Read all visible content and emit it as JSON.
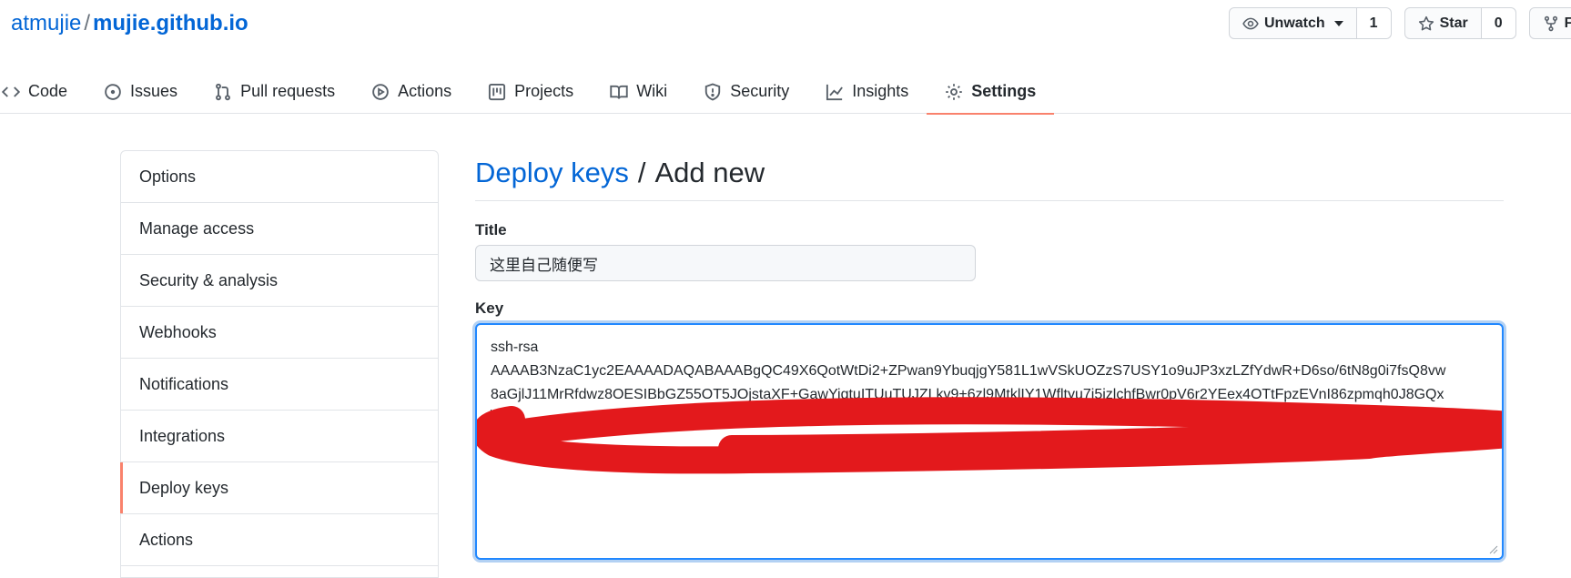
{
  "repo": {
    "owner": "atmujie",
    "separator": "/",
    "name": "mujie.github.io"
  },
  "actions": {
    "watch_label": "Unwatch",
    "watch_count": "1",
    "star_label": "Star",
    "star_count": "0",
    "fork_label": "Fo"
  },
  "tabs": [
    {
      "label": "Code",
      "icon": "code-icon"
    },
    {
      "label": "Issues",
      "icon": "issue-icon"
    },
    {
      "label": "Pull requests",
      "icon": "pull-request-icon"
    },
    {
      "label": "Actions",
      "icon": "play-icon"
    },
    {
      "label": "Projects",
      "icon": "project-icon"
    },
    {
      "label": "Wiki",
      "icon": "book-icon"
    },
    {
      "label": "Security",
      "icon": "shield-icon"
    },
    {
      "label": "Insights",
      "icon": "graph-icon"
    },
    {
      "label": "Settings",
      "icon": "gear-icon",
      "active": true
    }
  ],
  "sidebar": {
    "items": [
      {
        "label": "Options"
      },
      {
        "label": "Manage access"
      },
      {
        "label": "Security & analysis"
      },
      {
        "label": "Webhooks"
      },
      {
        "label": "Notifications"
      },
      {
        "label": "Integrations"
      },
      {
        "label": "Deploy keys",
        "selected": true
      },
      {
        "label": "Actions"
      }
    ]
  },
  "page": {
    "breadcrumb": "Deploy keys",
    "separator": "/",
    "heading": "Add new"
  },
  "form": {
    "title_label": "Title",
    "title_value": "这里自己随便写",
    "key_label": "Key",
    "key_value": "ssh-rsa\nAAAAB3NzaC1yc2EAAAADAQABAAABgQC49X6QotWtDi2+ZPwan9YbuqjgY581L1wVSkUOZzS7USY1o9uJP3xzLZfYdwR+D6so/6tN8g0i7fsQ8vw\n8aGjlJ11MrRfdwz8OESIBbGZ55OT5JOjstaXF+GawYigtuITUuTUJZLkv9+6zl9MtklIY1Wfltyu7j5izlchfBwr0pV6r2YEex4OTtFpzEVnI86zpmqh0J8GQx\n"
  },
  "colors": {
    "link": "#0366d6",
    "active_tab_underline": "#f9826c",
    "focus_border": "#2188ff",
    "redaction": "#e3191c"
  }
}
